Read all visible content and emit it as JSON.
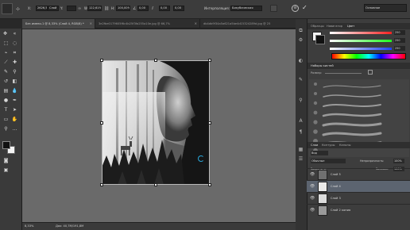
{
  "options_bar": {
    "x_label": "X:",
    "x_value": "2626,50",
    "units_dropdown": "Слой",
    "y_label": "Y:",
    "y_value": "",
    "w_label": "W:",
    "w_value": "122,61%",
    "h_label": "H:",
    "h_value": "100,00%",
    "angle_value": "0,00",
    "h_skew_value": "0,00",
    "interp_label": "Интерполяция:",
    "interp_value": "Бикубическая",
    "workspace_value": "Основное"
  },
  "tabs": [
    {
      "label": "Без имени-1 @ 8,33% (Слой 4, RGB/8) *",
      "active": true
    },
    {
      "label": "3e2fbe0179605f6c4b25f3fa255a10e.jpg @ 66,7%",
      "active": false
    },
    {
      "label": "db4db9f34a5a621a5be4d15324289d.jpg @ 25",
      "active": false
    }
  ],
  "status_bar": {
    "zoom": "8,33%",
    "doc_info": "Док: 40,7М/191,8М"
  },
  "color_panel": {
    "tabs": [
      "Образцы",
      "Навигатор",
      "Цвет"
    ],
    "active_tab": "Цвет",
    "sliders": [
      {
        "label": "",
        "value": "250",
        "color": "#ff3030"
      },
      {
        "label": "",
        "value": "250",
        "color": "#30ff30"
      },
      {
        "label": "",
        "value": "250",
        "color": "#3060ff"
      }
    ]
  },
  "brush_panel": {
    "tabs": [
      "Наборы кистей"
    ],
    "size_label": "Размер:"
  },
  "layers_panel": {
    "tabs": [
      "Слои",
      "Контуры",
      "Каналы"
    ],
    "active_tab": "Слои",
    "kind_dropdown": "Вид",
    "blend_mode": "Обычные",
    "opacity_label": "Непрозрачность:",
    "opacity_value": "100%",
    "lock_label": "Закрепить:",
    "fill_label": "Заливка:",
    "fill_value": "100%",
    "layers": [
      {
        "name": "Слой 5",
        "selected": false
      },
      {
        "name": "Слой 4",
        "selected": true
      },
      {
        "name": "Слой 3",
        "selected": false
      },
      {
        "name": "Слой 2 копия",
        "selected": false
      }
    ]
  },
  "colors": {
    "chrome_dark": "#282828",
    "panel": "#3d3d3d",
    "workspace": "#6a6a6a",
    "selection": "#5c6470",
    "accent_cursor": "#2aa6d8"
  }
}
